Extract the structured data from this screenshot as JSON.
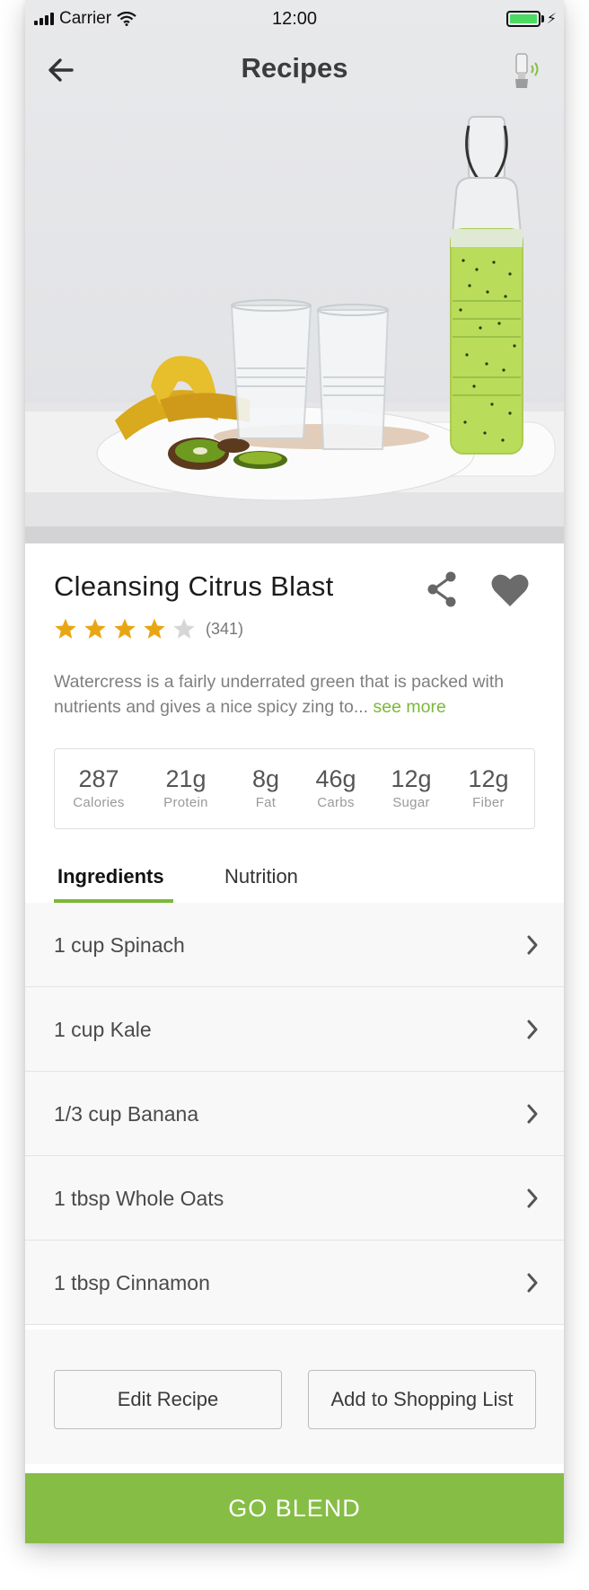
{
  "status_bar": {
    "carrier": "Carrier",
    "time": "12:00"
  },
  "nav": {
    "title": "Recipes",
    "back_icon": "arrow-left-icon",
    "device_icon": "blender-connected-icon"
  },
  "recipe": {
    "title": "Cleansing Citrus Blast",
    "rating": 4,
    "rating_max": 5,
    "rating_count": "(341)",
    "description": "Watercress is a fairly underrated green that is packed with nutrients and gives a nice spicy zing to...",
    "see_more": "see more"
  },
  "nutrition": [
    {
      "value": "287",
      "label": "Calories"
    },
    {
      "value": "21g",
      "label": "Protein"
    },
    {
      "value": "8g",
      "label": "Fat"
    },
    {
      "value": "46g",
      "label": "Carbs"
    },
    {
      "value": "12g",
      "label": "Sugar"
    },
    {
      "value": "12g",
      "label": "Fiber"
    }
  ],
  "tabs": [
    {
      "label": "Ingredients",
      "active": true
    },
    {
      "label": "Nutrition",
      "active": false
    }
  ],
  "ingredients": [
    "1 cup Spinach",
    "1 cup Kale",
    "1/3 cup Banana",
    "1 tbsp Whole Oats",
    "1 tbsp Cinnamon"
  ],
  "actions": {
    "edit": "Edit Recipe",
    "shopping": "Add to Shopping List"
  },
  "cta": {
    "label": "GO BLEND"
  },
  "colors": {
    "accent": "#86bd45",
    "link": "#7bb83a",
    "star": "#e8a615",
    "star_empty": "#d6d6d6"
  }
}
